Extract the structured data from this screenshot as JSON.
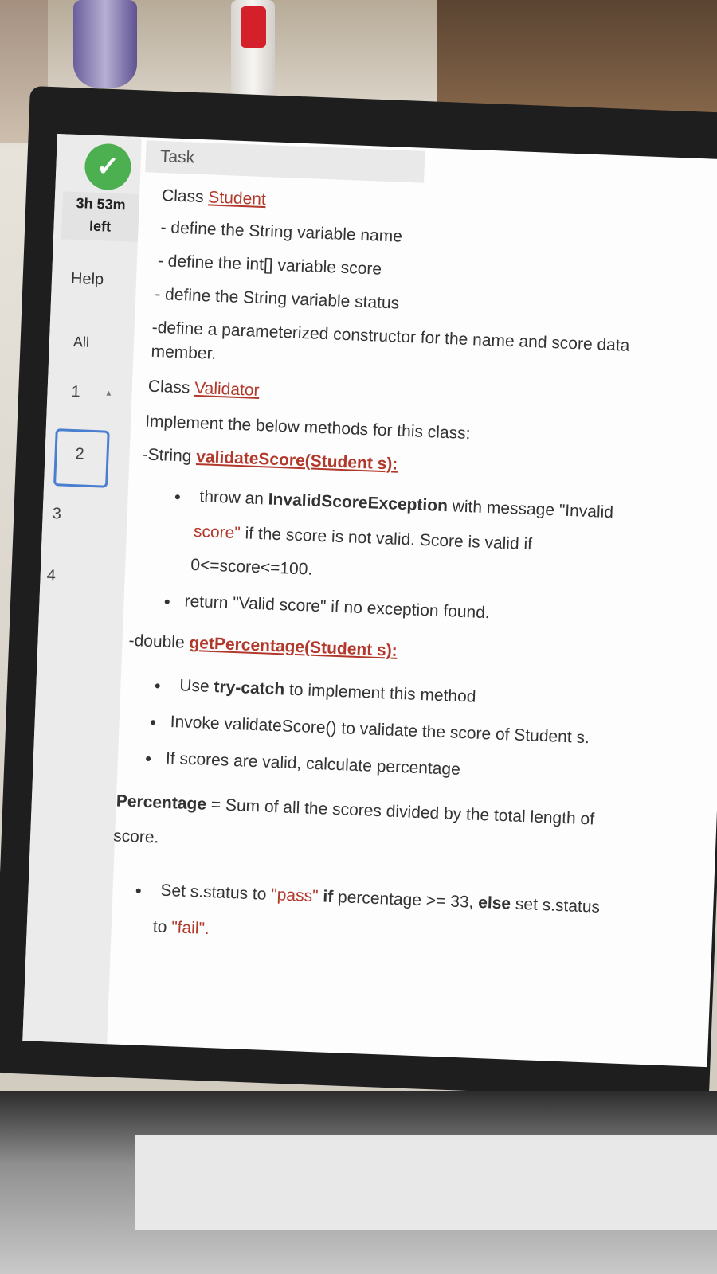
{
  "sidebar": {
    "timer_line1": "3h 53m",
    "timer_line2": "left",
    "help": "Help",
    "all": "All",
    "questions": [
      "1",
      "2",
      "3",
      "4"
    ]
  },
  "task": {
    "title": "Task",
    "class_student_prefix": "Class",
    "class_student": "Student",
    "student_lines": [
      "- define the String variable name",
      "- define the int[] variable score",
      "- define the String variable status",
      "-define a parameterized constructor for the name and score data",
      "member."
    ],
    "class_validator_prefix": "Class",
    "class_validator": "Validator",
    "implement": "Implement the below methods for this class:",
    "method1_prefix": "-String",
    "method1_name": "validateScore(Student s):",
    "m1_bullet1_a": "throw an",
    "m1_bullet1_b": "InvalidScoreException",
    "m1_bullet1_c": "with message \"Invalid",
    "m1_bullet1_d": "score\"",
    "m1_bullet1_e": "if the score is not valid. Score is valid if",
    "m1_bullet1_f": "0<=score<=100.",
    "m1_bullet2": "return \"Valid score\" if no exception found.",
    "method2_prefix": "-double",
    "method2_name": "getPercentage(Student s):",
    "m2_b1_a": "Use",
    "m2_b1_b": "try-catch",
    "m2_b1_c": "to implement this method",
    "m2_b2": "Invoke validateScore() to validate the score of Student s.",
    "m2_b3": "If scores are valid, calculate percentage",
    "pct_a": "Percentage",
    "pct_b": "= Sum of all the scores divided by the total length of",
    "pct_c": "score.",
    "status_a": "Set s.status to",
    "status_b": "\"pass\"",
    "status_c": "if",
    "status_d": "percentage >= 33,",
    "status_e": "else",
    "status_f": "set s.status",
    "status_g": "to",
    "status_h": "\"fail\"."
  }
}
